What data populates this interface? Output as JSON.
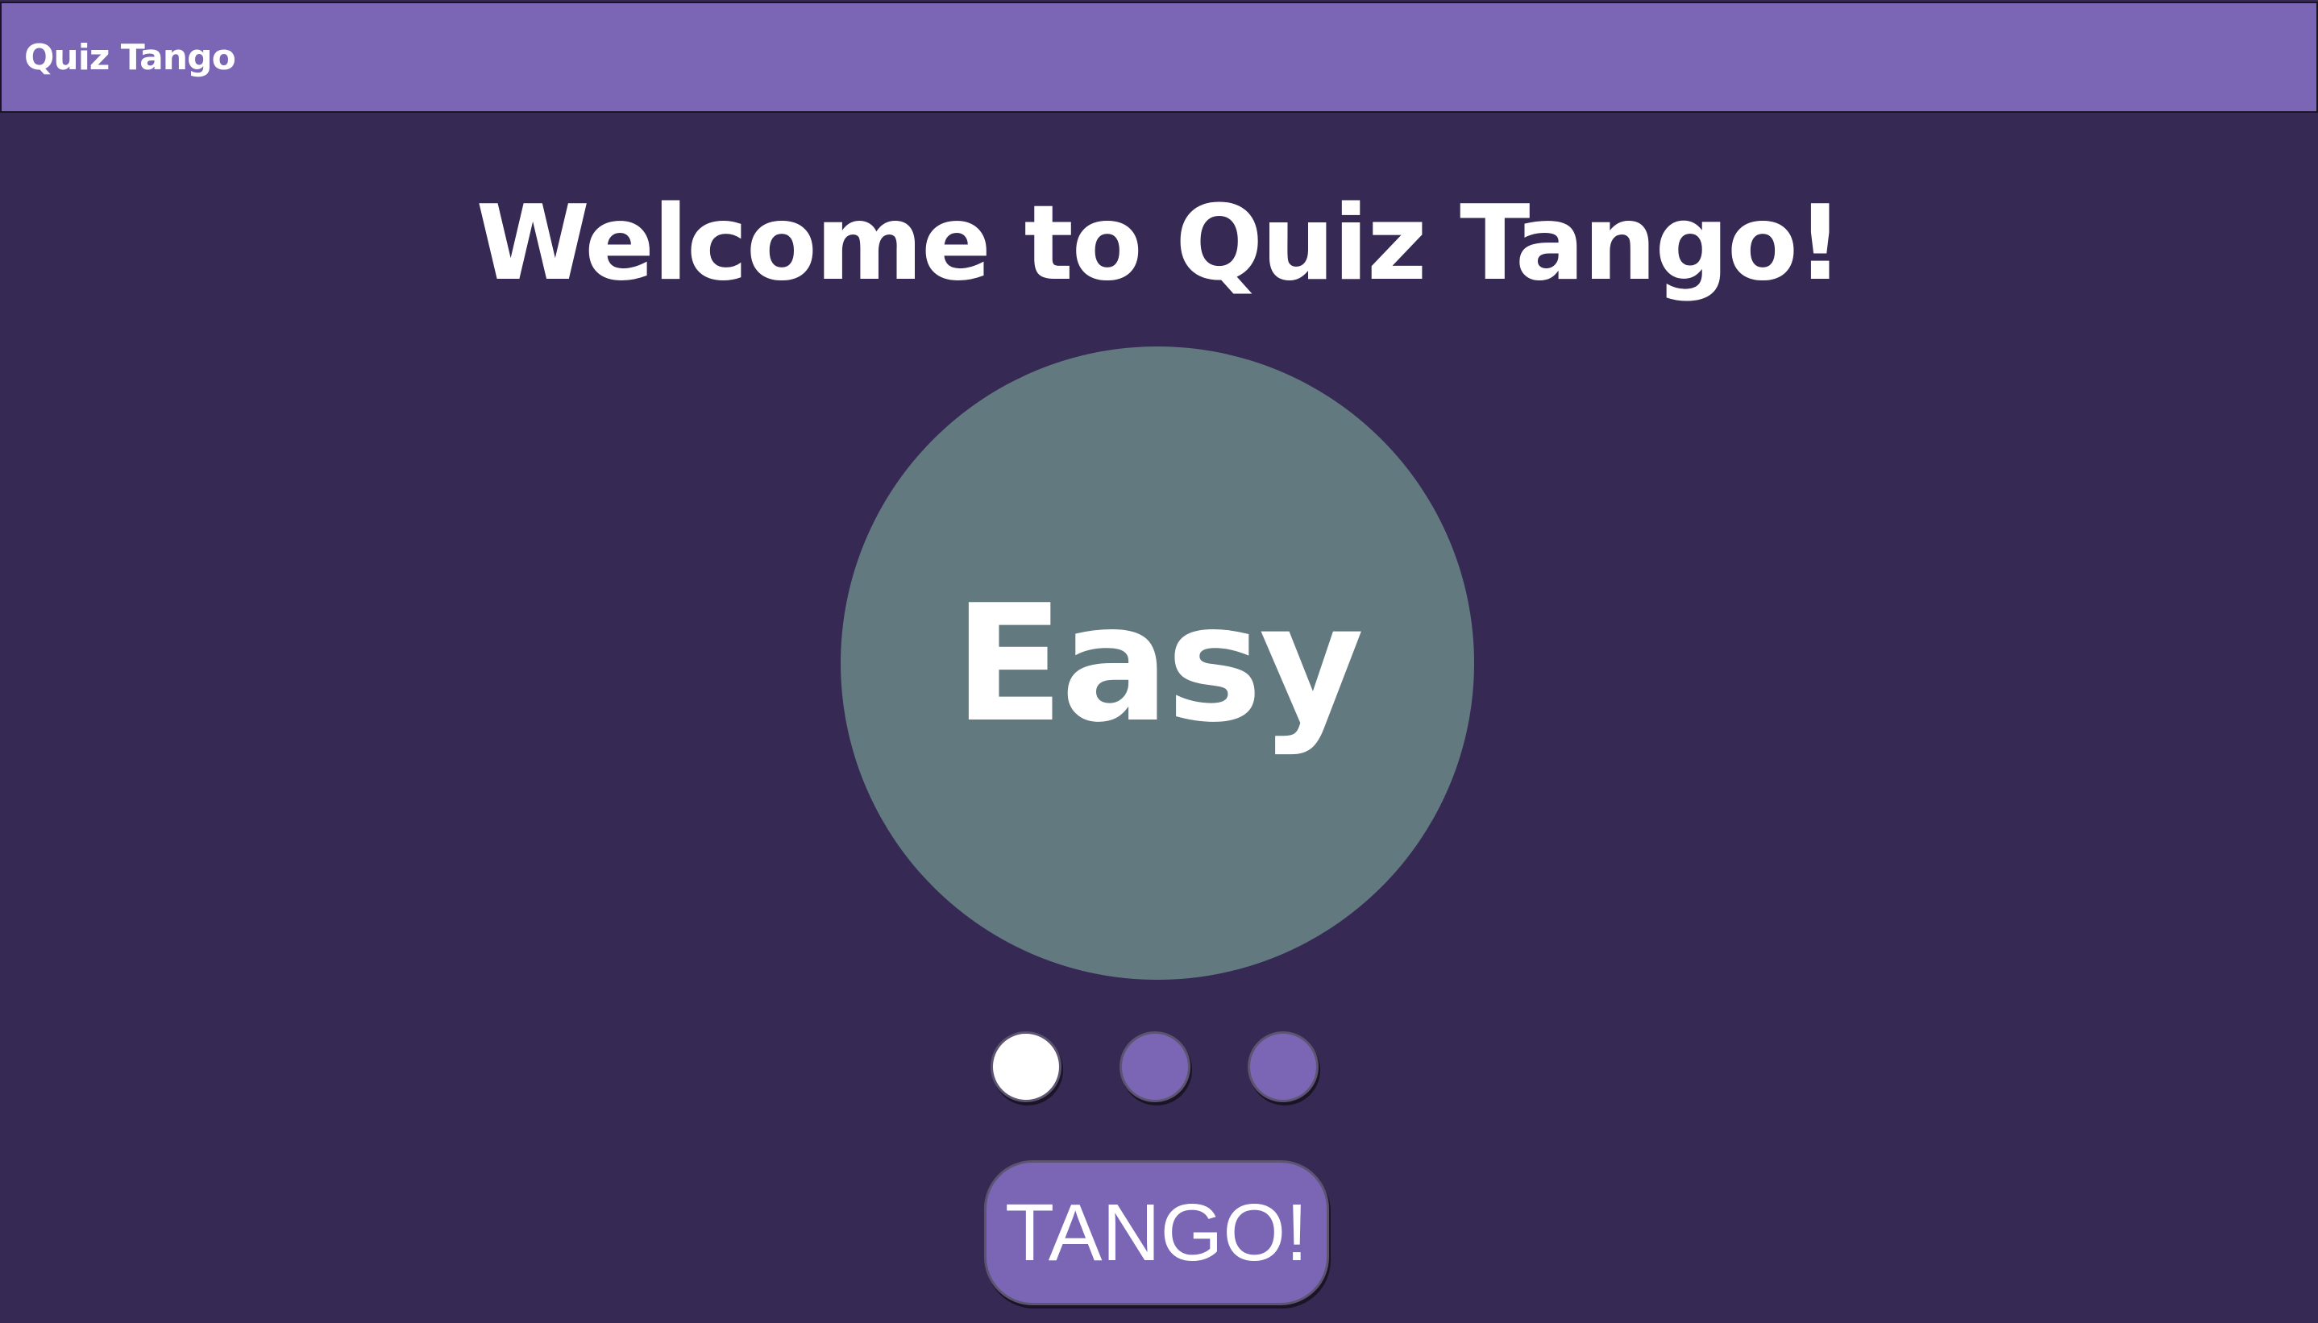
{
  "header": {
    "app_title": "Quiz Tango"
  },
  "main": {
    "headline": "Welcome to Quiz Tango!",
    "difficulty": {
      "current_label": "Easy",
      "selected_index": 0,
      "option_count": 3
    },
    "start_button_label": "TANGO!"
  },
  "colors": {
    "background": "#362a54",
    "accent": "#7a66b5",
    "circle": "#637980",
    "text": "#ffffff"
  }
}
